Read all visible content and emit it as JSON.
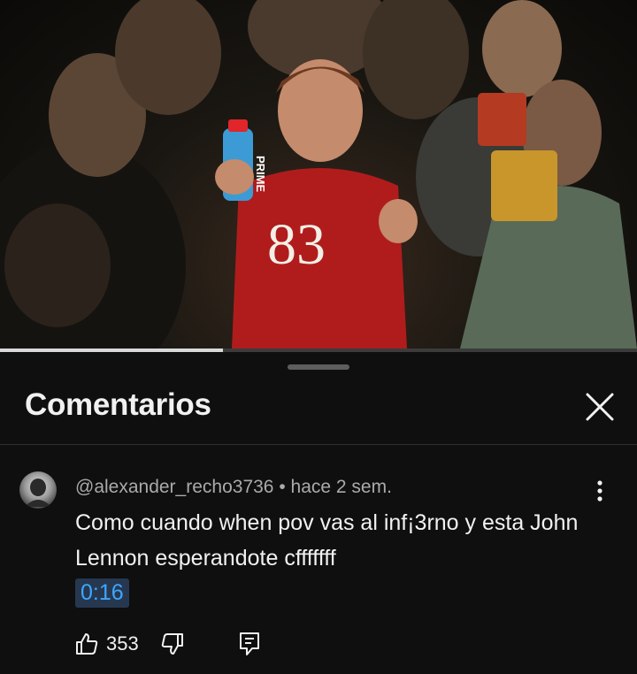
{
  "video": {
    "bottle_label": "PRIME",
    "jersey_number": "83",
    "progress_fraction": 0.35
  },
  "panel": {
    "title": "Comentarios",
    "close_icon": "close-icon"
  },
  "comment": {
    "author": "@alexander_recho3736",
    "separator": "•",
    "age": "hace 2 sem.",
    "text": "Como cuando when pov vas al inf¡3rno y esta John Lennon esperandote cfffffff",
    "timestamp": "0:16",
    "likes": "353",
    "icons": [
      "like-icon",
      "dislike-icon",
      "reply-icon",
      "more-vert-icon"
    ],
    "timestamp_color": "#3ea6ff"
  }
}
